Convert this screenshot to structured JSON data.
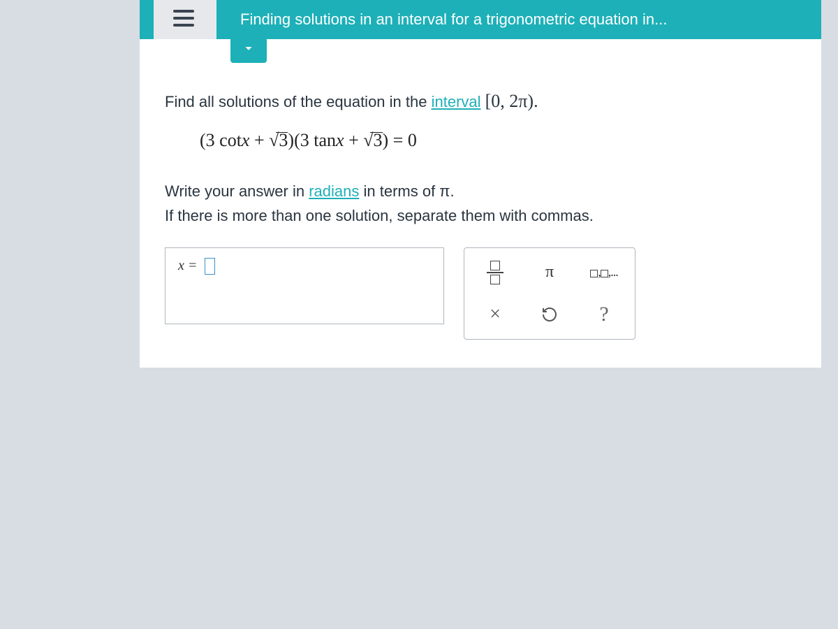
{
  "header": {
    "title": "Finding solutions in an interval for a trigonometric equation in..."
  },
  "problem": {
    "line1_pre": "Find all solutions of the equation in the ",
    "interval_label": "interval",
    "interval_expr": "[0, 2π).",
    "equation": "(3 cotx + √3)(3 tanx + √3) = 0",
    "line2_pre": "Write your answer in ",
    "radians_label": "radians",
    "line2_post": " in terms of π.",
    "line3": "If there is more than one solution, separate them with commas."
  },
  "answer": {
    "prefix": "x ="
  },
  "tools": {
    "pi": "π",
    "list": "▯,▯,...",
    "clear": "×",
    "help": "?"
  }
}
